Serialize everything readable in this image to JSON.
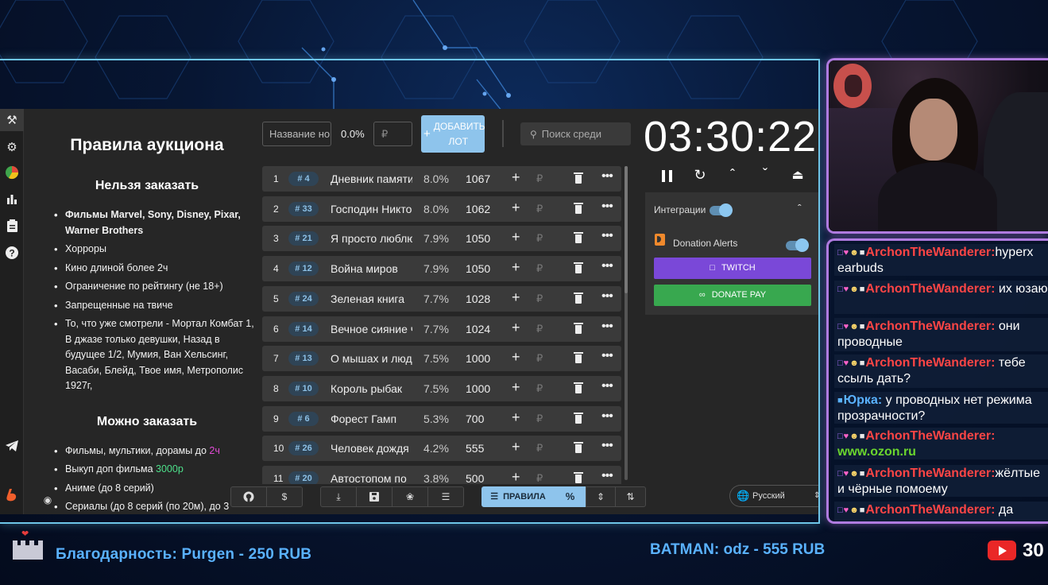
{
  "rules": {
    "title": "Правила аукциона",
    "forbidden_heading": "Нельзя заказать",
    "forbidden": [
      "Фильмы Marvel, Sony, Disney, Pixar, Warner Brothers",
      "Хорроры",
      "Кино длиной более 2ч",
      "Ограничение по рейтингу (не 18+)",
      "Запрещенные на твиче",
      "То, что уже смотрели - Мортал Комбат 1, В джазе только девушки, Назад в будущее 1/2, Мумия, Ван Хельсинг, Васаби, Блейд, Твое имя, Метрополис 1927г,"
    ],
    "allowed_heading": "Можно заказать",
    "allowed_1_prefix": "Фильмы, мультики, дорамы до ",
    "allowed_1_highlight": "2ч",
    "allowed_2_prefix": "Выкуп доп фильма ",
    "allowed_2_highlight": "3000р",
    "allowed_3": "Аниме (до 8 серий)",
    "allowed_4": "Сериалы (до 8 серий (по 20м), до 3"
  },
  "toolbar": {
    "name_placeholder": "Название но",
    "percent": "0.0%",
    "rub_placeholder": "₽",
    "add_lot": "ДОБАВИТЬ ЛОТ",
    "add_plus": "+",
    "search_placeholder": "Поиск среди"
  },
  "lots": [
    {
      "n": "1",
      "tag": "4",
      "name": "Дневник памяти",
      "pct": "8.0%",
      "amt": "1067"
    },
    {
      "n": "2",
      "tag": "33",
      "name": "Господин Никто",
      "pct": "8.0%",
      "amt": "1062"
    },
    {
      "n": "3",
      "tag": "21",
      "name": "Я просто люблю",
      "pct": "7.9%",
      "amt": "1050"
    },
    {
      "n": "4",
      "tag": "12",
      "name": "Война миров",
      "pct": "7.9%",
      "amt": "1050"
    },
    {
      "n": "5",
      "tag": "24",
      "name": "Зеленая книга",
      "pct": "7.7%",
      "amt": "1028"
    },
    {
      "n": "6",
      "tag": "14",
      "name": "Вечное сияние ч",
      "pct": "7.7%",
      "amt": "1024"
    },
    {
      "n": "7",
      "tag": "13",
      "name": "О мышах и людях",
      "pct": "7.5%",
      "amt": "1000"
    },
    {
      "n": "8",
      "tag": "10",
      "name": "Король рыбак",
      "pct": "7.5%",
      "amt": "1000"
    },
    {
      "n": "9",
      "tag": "6",
      "name": "Форест Гамп",
      "pct": "5.3%",
      "amt": "700"
    },
    {
      "n": "10",
      "tag": "26",
      "name": "Человек дождя",
      "pct": "4.2%",
      "amt": "555"
    },
    {
      "n": "11",
      "tag": "20",
      "name": "Автостопом по",
      "pct": "3.8%",
      "amt": "500"
    }
  ],
  "lot_add_symbol": "+",
  "lot_rub_symbol": "₽",
  "lot_more_symbol": "•••",
  "lot_tag_prefix": "#",
  "timer": "03:30:22",
  "integrations": {
    "label": "Интеграции",
    "donation_alerts": "Donation Alerts",
    "twitch": "TWITCH",
    "donate_pay": "DONATE PAY"
  },
  "bottom_toolbar": {
    "rules_btn": "ПРАВИЛА",
    "percent_btn": "%",
    "dollar_btn": "$",
    "language": "Русский"
  },
  "chat": [
    {
      "user": "ArchonTheWanderer:",
      "text": "hyperx earbuds",
      "color": "#ff4545",
      "link": false
    },
    {
      "user": "ArchonTheWanderer:",
      "text": " их юзаю",
      "color": "#ff4545",
      "link": false
    },
    {
      "user": "ArchonTheWanderer:",
      "text": " они проводные",
      "color": "#ff4545",
      "link": false
    },
    {
      "user": "ArchonTheWanderer:",
      "text": " тебе ссыль дать?",
      "color": "#ff4545",
      "link": false
    },
    {
      "user": "Юрка:",
      "text": " у проводных нет режима прозрачности?",
      "color": "#5ab2ff",
      "link": false
    },
    {
      "user": "ArchonTheWanderer:",
      "text": "www.ozon.ru",
      "color": "#ff4545",
      "link": true
    },
    {
      "user": "ArchonTheWanderer:",
      "text": "жёлтые и чёрные помоему",
      "color": "#ff4545",
      "link": false
    },
    {
      "user": "ArchonTheWanderer:",
      "text": " да",
      "color": "#ff4545",
      "link": false
    }
  ],
  "ticker": {
    "left": "Благодарность: Purgen - 250 RUB",
    "right": "BATMAN: odz - 555 RUB",
    "viewers": "30"
  }
}
